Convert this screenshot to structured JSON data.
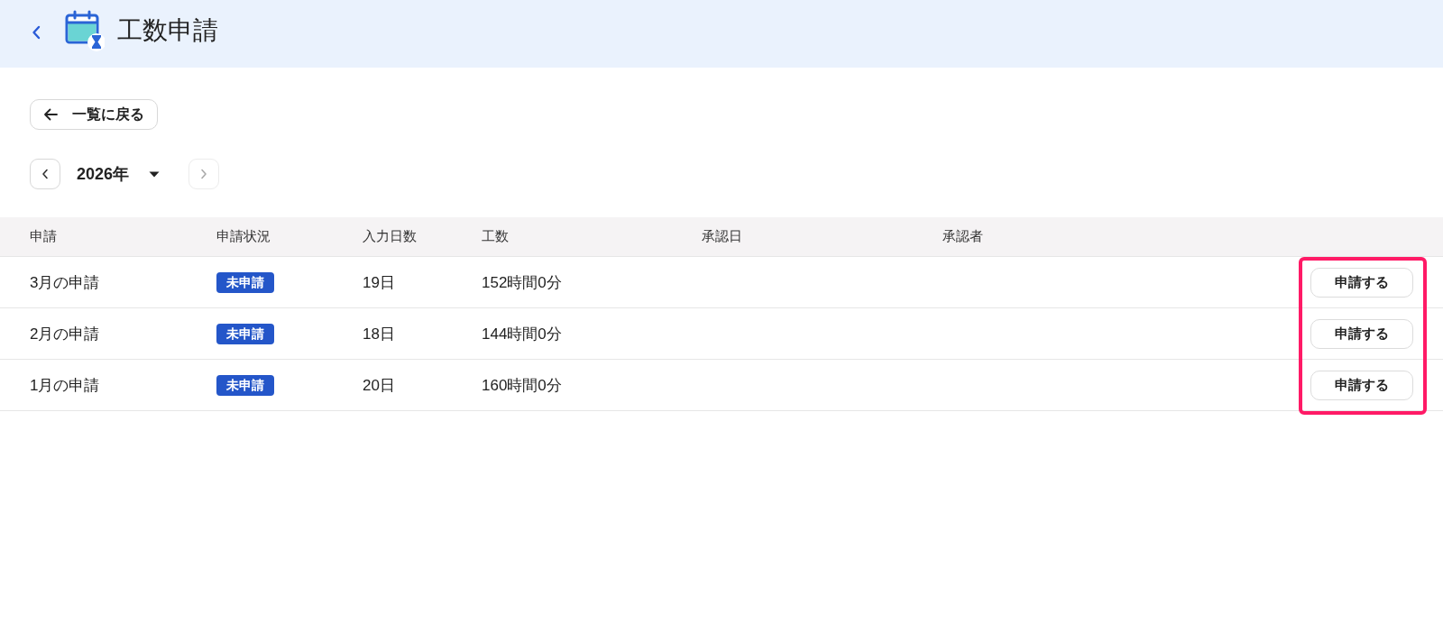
{
  "header": {
    "title": "工数申請"
  },
  "back_link": {
    "label": "一覧に戻る"
  },
  "year_nav": {
    "year": "2026年",
    "prev_disabled": false,
    "next_disabled": true
  },
  "table": {
    "columns": [
      "申請",
      "申請状況",
      "入力日数",
      "工数",
      "承認日",
      "承認者"
    ],
    "rows": [
      {
        "name": "3月の申請",
        "status": "未申請",
        "days": "19日",
        "hours": "152時間0分",
        "action": "申請する"
      },
      {
        "name": "2月の申請",
        "status": "未申請",
        "days": "18日",
        "hours": "144時間0分",
        "action": "申請する"
      },
      {
        "name": "1月の申請",
        "status": "未申請",
        "days": "20日",
        "hours": "160時間0分",
        "action": "申請する"
      }
    ]
  },
  "annotation": {
    "highlight_actions": true
  }
}
